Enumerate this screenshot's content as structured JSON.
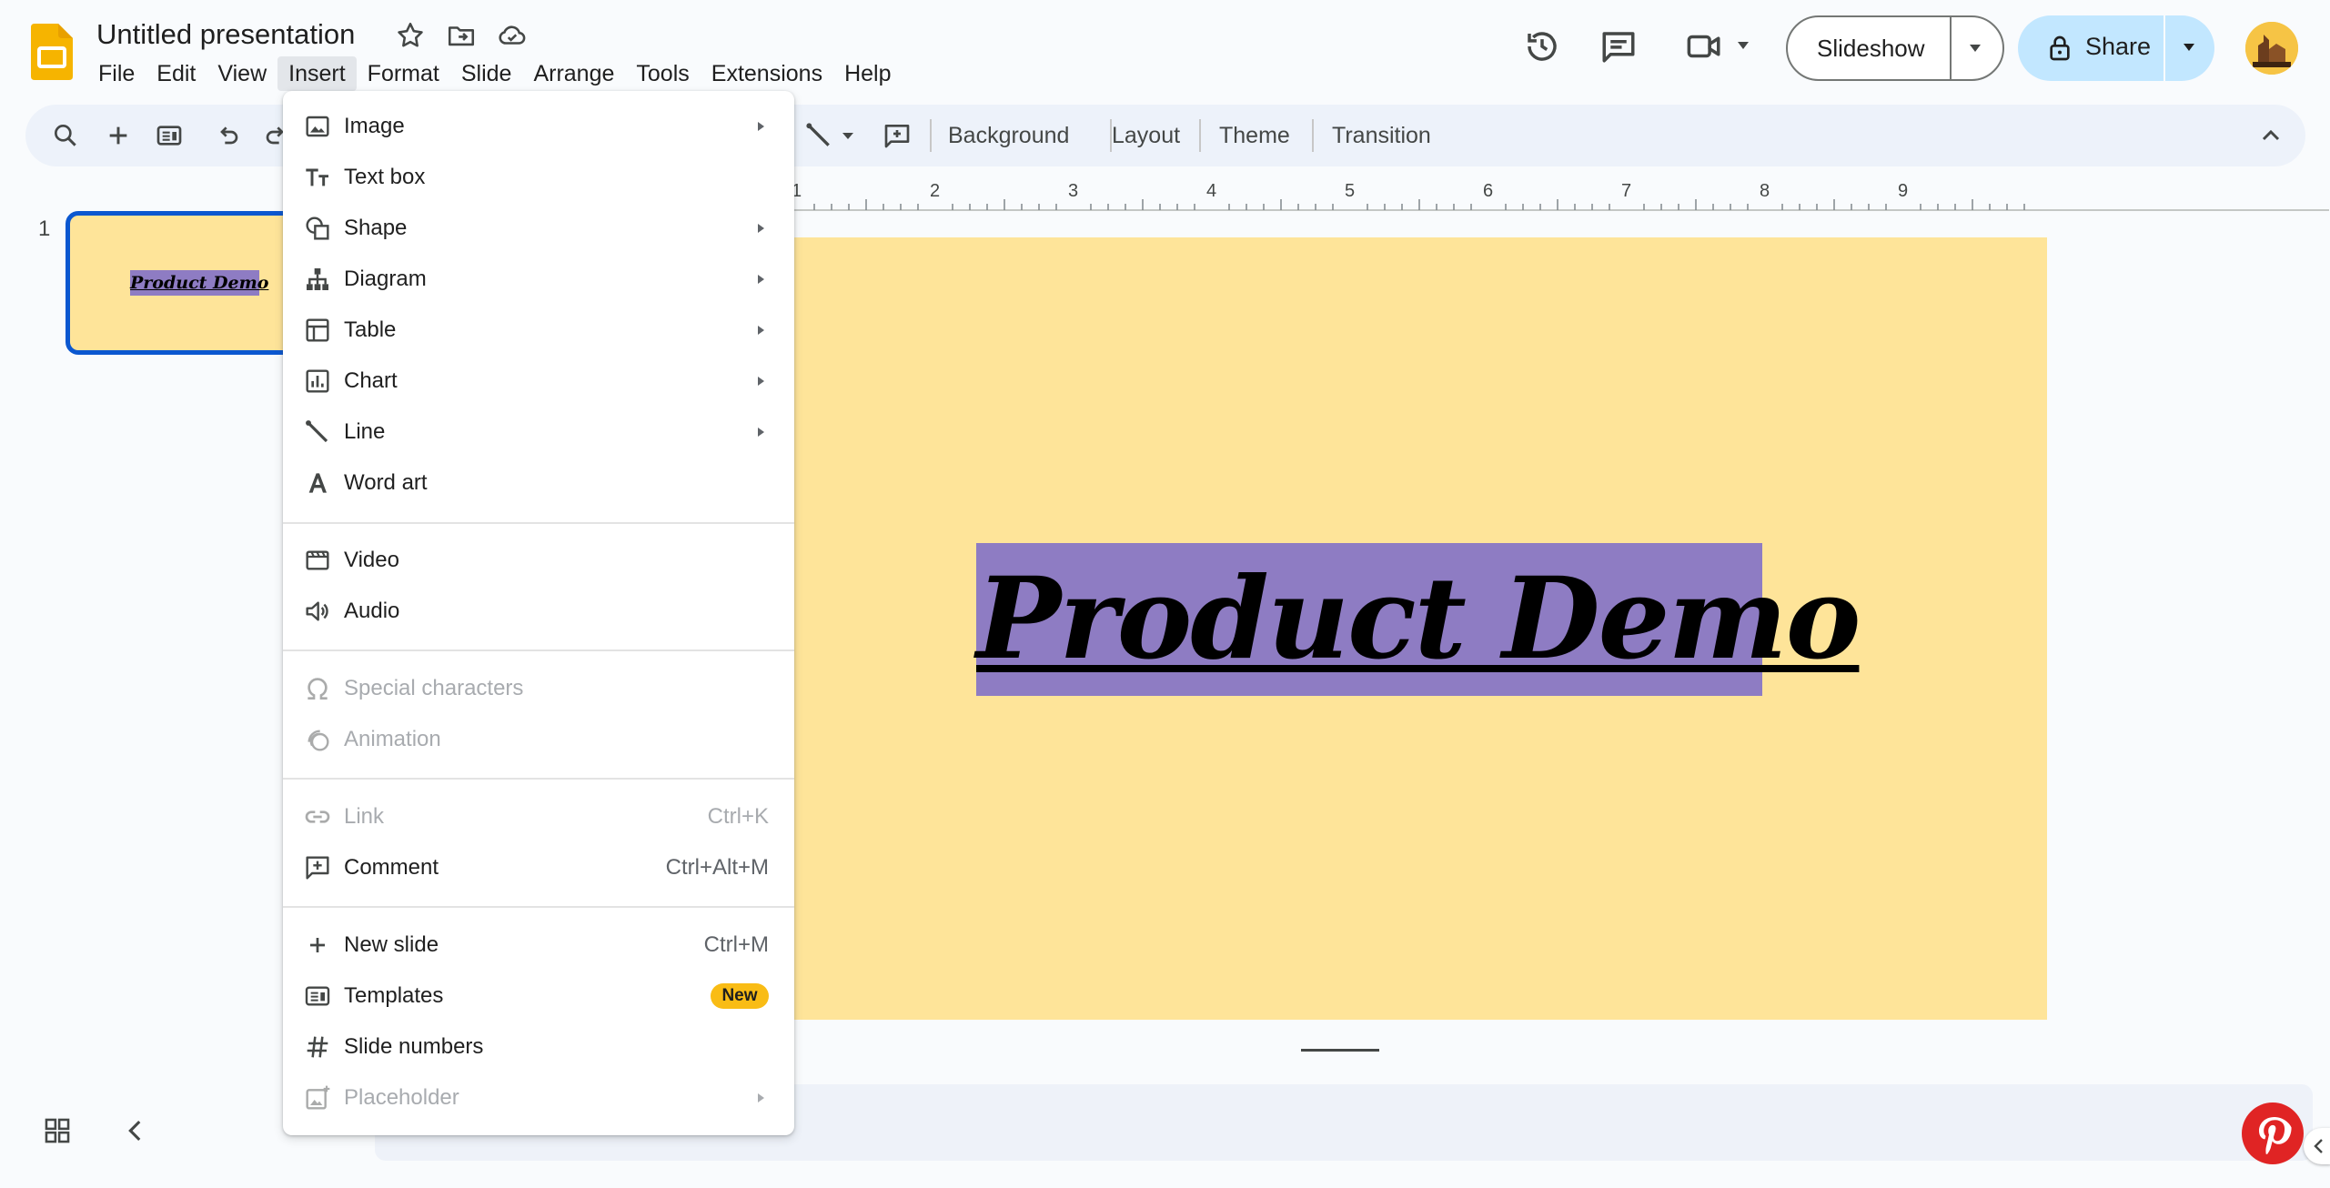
{
  "app": {
    "logo_icon": "slides-logo-icon",
    "title": "Untitled presentation",
    "accent_color": "#0b57d0",
    "share_bg_color": "#c2e7ff"
  },
  "menubar": [
    {
      "label": "File"
    },
    {
      "label": "Edit"
    },
    {
      "label": "View"
    },
    {
      "label": "Insert"
    },
    {
      "label": "Format"
    },
    {
      "label": "Slide"
    },
    {
      "label": "Arrange"
    },
    {
      "label": "Tools"
    },
    {
      "label": "Extensions"
    },
    {
      "label": "Help"
    }
  ],
  "active_menu": "Insert",
  "header": {
    "slideshow_label": "Slideshow",
    "share_label": "Share"
  },
  "toolbar": {
    "background_label": "Background",
    "layout_label": "Layout",
    "theme_label": "Theme",
    "transition_label": "Transition"
  },
  "filmstrip": {
    "slides": [
      {
        "number": "1",
        "title": "Product Demo"
      }
    ]
  },
  "ruler": {
    "marks": [
      "1",
      "2",
      "3",
      "4",
      "5",
      "6",
      "7",
      "8",
      "9"
    ]
  },
  "slide": {
    "title": "Product Demo",
    "background_color": "#fee499",
    "title_box_color": "#8e7cc3"
  },
  "insert_menu": {
    "items": [
      {
        "label": "Image",
        "icon": "image-icon",
        "submenu": true
      },
      {
        "label": "Text box",
        "icon": "text-box-icon"
      },
      {
        "label": "Shape",
        "icon": "shape-icon",
        "submenu": true
      },
      {
        "label": "Diagram",
        "icon": "diagram-icon",
        "submenu": true
      },
      {
        "label": "Table",
        "icon": "table-icon",
        "submenu": true
      },
      {
        "label": "Chart",
        "icon": "chart-icon",
        "submenu": true
      },
      {
        "label": "Line",
        "icon": "line-icon",
        "submenu": true
      },
      {
        "label": "Word art",
        "icon": "word-art-icon"
      },
      {
        "label": "Video",
        "icon": "video-icon"
      },
      {
        "label": "Audio",
        "icon": "audio-icon"
      },
      {
        "label": "Special characters",
        "icon": "omega-icon",
        "disabled": true
      },
      {
        "label": "Animation",
        "icon": "animation-icon",
        "disabled": true
      },
      {
        "label": "Link",
        "icon": "link-icon",
        "shortcut": "Ctrl+K",
        "disabled": true
      },
      {
        "label": "Comment",
        "icon": "add-comment-icon",
        "shortcut": "Ctrl+Alt+M"
      },
      {
        "label": "New slide",
        "icon": "plus-icon",
        "shortcut": "Ctrl+M"
      },
      {
        "label": "Templates",
        "icon": "templates-icon",
        "badge": "New",
        "badge_color": "#f9bc15"
      },
      {
        "label": "Slide numbers",
        "icon": "hash-icon"
      },
      {
        "label": "Placeholder",
        "icon": "placeholder-icon",
        "submenu": true,
        "disabled": true
      }
    ]
  }
}
